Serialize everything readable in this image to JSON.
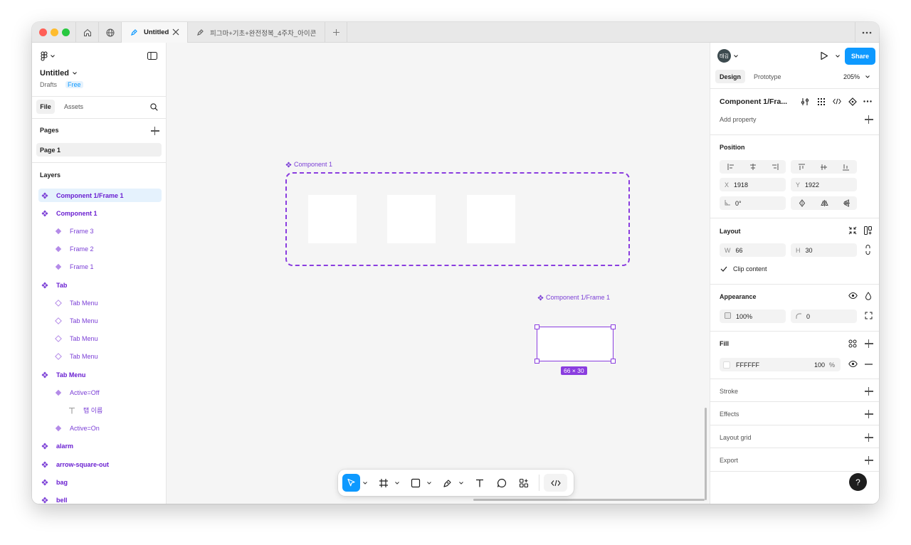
{
  "browser": {
    "tabs": [
      {
        "label": "Untitled",
        "active": true
      },
      {
        "label": "피그마+기초+완전정복_4주차_아이콘",
        "active": false
      }
    ]
  },
  "file": {
    "name": "Untitled",
    "location": "Drafts",
    "plan": "Free"
  },
  "left_panel": {
    "tabs": [
      "File",
      "Assets"
    ],
    "pages_label": "Pages",
    "pages": [
      "Page 1"
    ],
    "layers_label": "Layers",
    "layers": [
      {
        "label": "Component 1/Frame 1",
        "type": "component",
        "indent": 0,
        "selected": true
      },
      {
        "label": "Component 1",
        "type": "component",
        "indent": 0
      },
      {
        "label": "Frame 3",
        "type": "instance",
        "indent": 1
      },
      {
        "label": "Frame 2",
        "type": "instance",
        "indent": 1
      },
      {
        "label": "Frame 1",
        "type": "instance",
        "indent": 1
      },
      {
        "label": "Tab",
        "type": "component",
        "indent": 0
      },
      {
        "label": "Tab Menu",
        "type": "instance-outline",
        "indent": 1
      },
      {
        "label": "Tab Menu",
        "type": "instance-outline",
        "indent": 1
      },
      {
        "label": "Tab Menu",
        "type": "instance-outline",
        "indent": 1
      },
      {
        "label": "Tab Menu",
        "type": "instance-outline",
        "indent": 1
      },
      {
        "label": "Tab Menu",
        "type": "component",
        "indent": 0
      },
      {
        "label": "Active=Off",
        "type": "instance",
        "indent": 1
      },
      {
        "label": "탭 이름",
        "type": "text",
        "indent": 2
      },
      {
        "label": "Active=On",
        "type": "instance",
        "indent": 1
      },
      {
        "label": "alarm",
        "type": "component",
        "indent": 0
      },
      {
        "label": "arrow-square-out",
        "type": "component",
        "indent": 0
      },
      {
        "label": "bag",
        "type": "component",
        "indent": 0
      },
      {
        "label": "bell",
        "type": "component",
        "indent": 0
      }
    ]
  },
  "canvas": {
    "component_label": "Component 1",
    "small_component_label": "Component 1/Frame 1",
    "size_badge": "66 × 30"
  },
  "right_panel": {
    "avatar": "태김",
    "share_label": "Share",
    "tabs": [
      "Design",
      "Prototype"
    ],
    "zoom": "205%",
    "selection_name": "Component 1/Fra...",
    "add_property": "Add property",
    "position_label": "Position",
    "x": "1918",
    "y": "1922",
    "rotation": "0°",
    "layout_label": "Layout",
    "w": "66",
    "h": "30",
    "clip_content": "Clip content",
    "appearance_label": "Appearance",
    "opacity": "100%",
    "radius": "0",
    "fill_label": "Fill",
    "fill_hex": "FFFFFF",
    "fill_opacity": "100",
    "fill_unit": "%",
    "stroke_label": "Stroke",
    "effects_label": "Effects",
    "layout_grid_label": "Layout grid",
    "export_label": "Export",
    "help": "?"
  },
  "colors": {
    "accent": "#0d99ff",
    "component": "#7b3fd6",
    "selection_bg": "#e5f2fd"
  }
}
